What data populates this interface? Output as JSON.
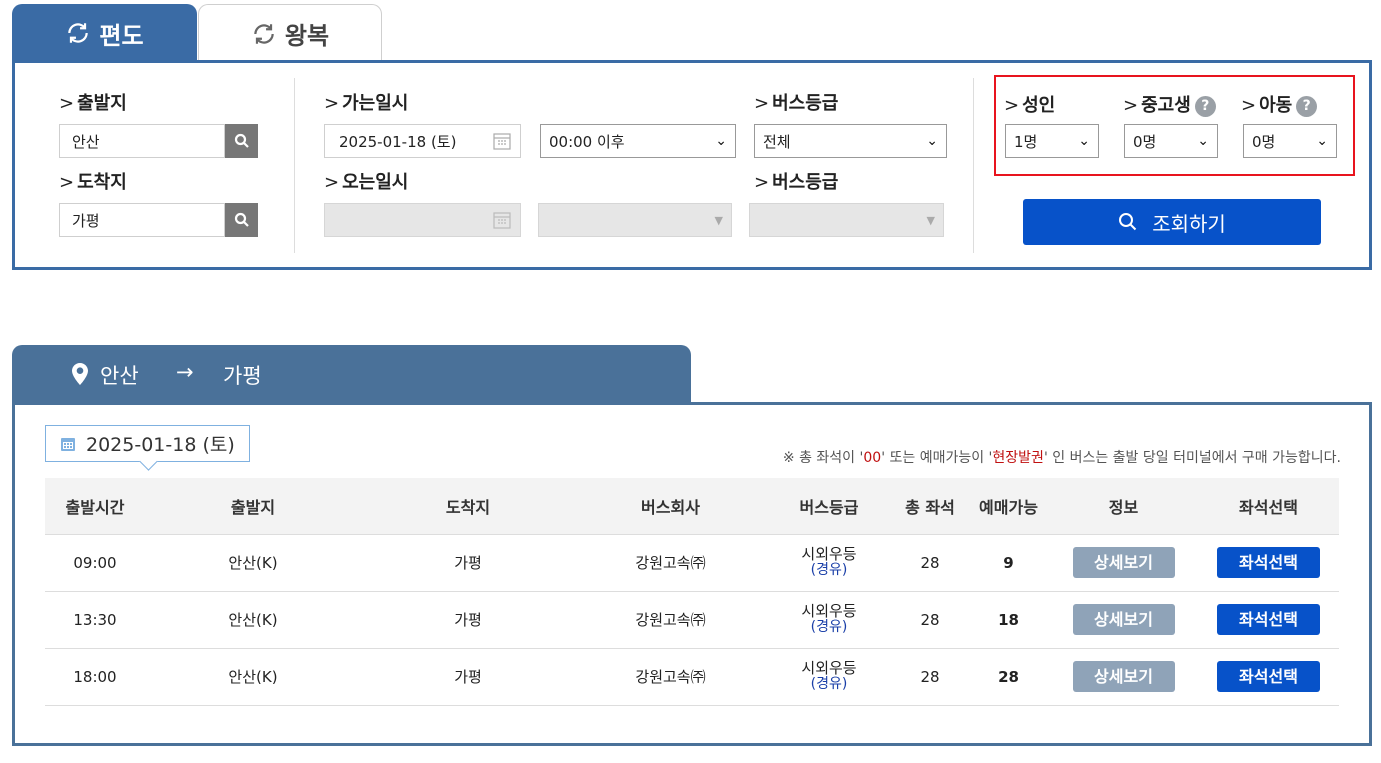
{
  "tabs": [
    {
      "label": "편도",
      "active": true
    },
    {
      "label": "왕복",
      "active": false
    }
  ],
  "search": {
    "departure_label": "출발지",
    "departure_value": "안산",
    "arrival_label": "도착지",
    "arrival_value": "가평",
    "go_date_label": "가는일시",
    "go_date_value": "2025-01-18 (토)",
    "go_time_value": "00:00 이후",
    "bus_grade_label": "버스등급",
    "bus_grade_value": "전체",
    "return_date_label": "오는일시",
    "return_bus_grade_label": "버스등급",
    "adult_label": "성인",
    "adult_value": "1명",
    "student_label": "중고생",
    "student_value": "0명",
    "child_label": "아동",
    "child_value": "0명",
    "help_glyph": "?",
    "lookup_label": "조회하기"
  },
  "route": {
    "from": "안산",
    "arrow": "→",
    "to": "가평"
  },
  "results": {
    "date": "2025-01-18 (토)",
    "notice_prefix": "※ 총 좌석이 '",
    "notice_zero": "00",
    "notice_mid": "' 또는 예매가능이 '",
    "notice_onsite": "현장발권",
    "notice_suffix": "' 인 버스는 출발 당일 터미널에서 구매 가능합니다.",
    "columns": [
      "출발시간",
      "출발지",
      "도착지",
      "버스회사",
      "버스등급",
      "총 좌석",
      "예매가능",
      "정보",
      "좌석선택"
    ],
    "rows": [
      {
        "time": "09:00",
        "from": "안산(K)",
        "to": "가평",
        "company": "강원고속㈜",
        "grade": "시외우등",
        "via": "(경유)",
        "total": "28",
        "available": "9",
        "detail": "상세보기",
        "seat": "좌석선택"
      },
      {
        "time": "13:30",
        "from": "안산(K)",
        "to": "가평",
        "company": "강원고속㈜",
        "grade": "시외우등",
        "via": "(경유)",
        "total": "28",
        "available": "18",
        "detail": "상세보기",
        "seat": "좌석선택"
      },
      {
        "time": "18:00",
        "from": "안산(K)",
        "to": "가평",
        "company": "강원고속㈜",
        "grade": "시외우등",
        "via": "(경유)",
        "total": "28",
        "available": "28",
        "detail": "상세보기",
        "seat": "좌석선택"
      }
    ]
  },
  "colors": {
    "primary_blue": "#3a6ba5",
    "button_blue": "#0752c9",
    "route_header": "#4a7199",
    "highlight_red": "#e8141e"
  }
}
